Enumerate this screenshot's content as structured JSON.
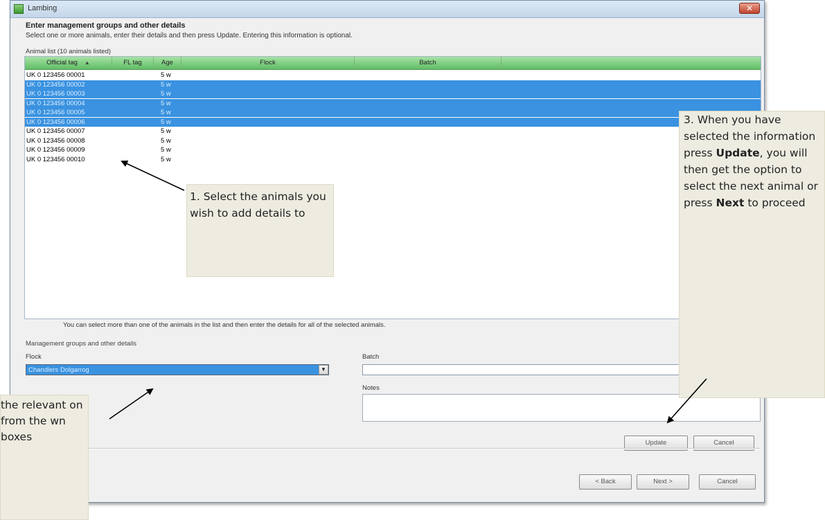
{
  "window": {
    "title": "Lambing",
    "close_glyph": "✕"
  },
  "header": {
    "heading": "Enter management groups and other details",
    "subtext": "Select one or more animals, enter their details and then press Update. Entering this information is optional."
  },
  "animal_list": {
    "label": "Animal list (10 animals listed)",
    "columns": [
      "Official tag",
      "FL tag",
      "Age",
      "Flock",
      "Batch"
    ],
    "sort_indicator": "▲",
    "rows": [
      {
        "tag": "UK 0 123456 00001",
        "age": "5 w",
        "selected": false
      },
      {
        "tag": "UK 0 123456 00002",
        "age": "5 w",
        "selected": true
      },
      {
        "tag": "UK 0 123456 00003",
        "age": "5 w",
        "selected": true
      },
      {
        "tag": "UK 0 123456 00004",
        "age": "5 w",
        "selected": true
      },
      {
        "tag": "UK 0 123456 00005",
        "age": "5 w",
        "selected": true
      },
      {
        "tag": "UK 0 123456 00006",
        "age": "5 w",
        "selected": true
      },
      {
        "tag": "UK 0 123456 00007",
        "age": "5 w",
        "selected": false
      },
      {
        "tag": "UK 0 123456 00008",
        "age": "5 w",
        "selected": false
      },
      {
        "tag": "UK 0 123456 00009",
        "age": "5 w",
        "selected": false
      },
      {
        "tag": "UK 0 123456 00010",
        "age": "5 w",
        "selected": false
      }
    ],
    "footer_note": "You can select more than one of the animals in the list and then enter the details for all of the selected animals."
  },
  "details": {
    "group_label": "Management groups and other details",
    "flock_label": "Flock",
    "flock_value": "Chandlers Dolgarrog",
    "batch_label": "Batch",
    "batch_value": "",
    "notes_label": "Notes"
  },
  "buttons": {
    "update": "Update",
    "cancel_small": "Cancel",
    "back": "< Back",
    "next": "Next >",
    "cancel": "Cancel"
  },
  "callouts": {
    "c1": "1. Select the animals you wish to add details to",
    "c2": "the relevant on from the wn boxes",
    "c3_a": "3. When you have selected the information press ",
    "c3_update": "Update",
    "c3_b": ", you will then get the option to select the next animal or press ",
    "c3_next": "Next",
    "c3_c": " to proceed"
  }
}
